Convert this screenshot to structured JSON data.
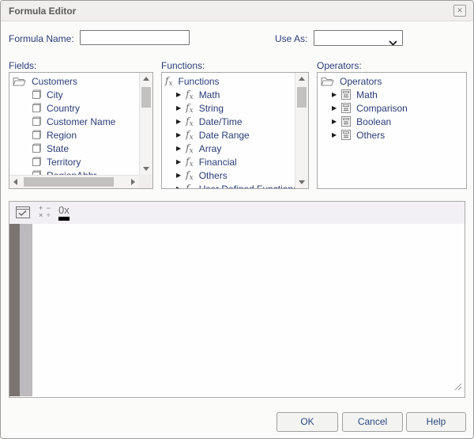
{
  "window": {
    "title": "Formula Editor"
  },
  "icons": {
    "close": "✕"
  },
  "form": {
    "formula_name": {
      "label": "Formula Name:",
      "value": ""
    },
    "use_as": {
      "label": "Use As:",
      "value": ""
    }
  },
  "panels": {
    "fields": {
      "label": "Fields:",
      "root": "Customers",
      "items": [
        "City",
        "Country",
        "Customer Name",
        "Region",
        "State",
        "Territory",
        "RegionAbbr"
      ]
    },
    "functions": {
      "label": "Functions:",
      "root": "Functions",
      "items": [
        "Math",
        "String",
        "Date/Time",
        "Date Range",
        "Array",
        "Financial",
        "Others",
        "User Defined Functions"
      ]
    },
    "operators": {
      "label": "Operators:",
      "root": "Operators",
      "items": [
        "Math",
        "Comparison",
        "Boolean",
        "Others"
      ]
    }
  },
  "editor": {
    "plus_minus_top": "+ −",
    "plus_minus_bottom": "× ÷",
    "hex_label": "0x",
    "value": ""
  },
  "buttons": {
    "ok": "OK",
    "cancel": "Cancel",
    "help": "Help"
  },
  "colors": {
    "accent_text": "#2b3c79",
    "button_text": "#2b4a7f",
    "title_text": "#5a5a5a",
    "titlebar_bg": "#f0efed",
    "toolbar_bg": "#f2f0f4",
    "gutter_dark": "#7b7470",
    "gutter_light": "#bdbabd",
    "hex_bar": "#000000"
  }
}
